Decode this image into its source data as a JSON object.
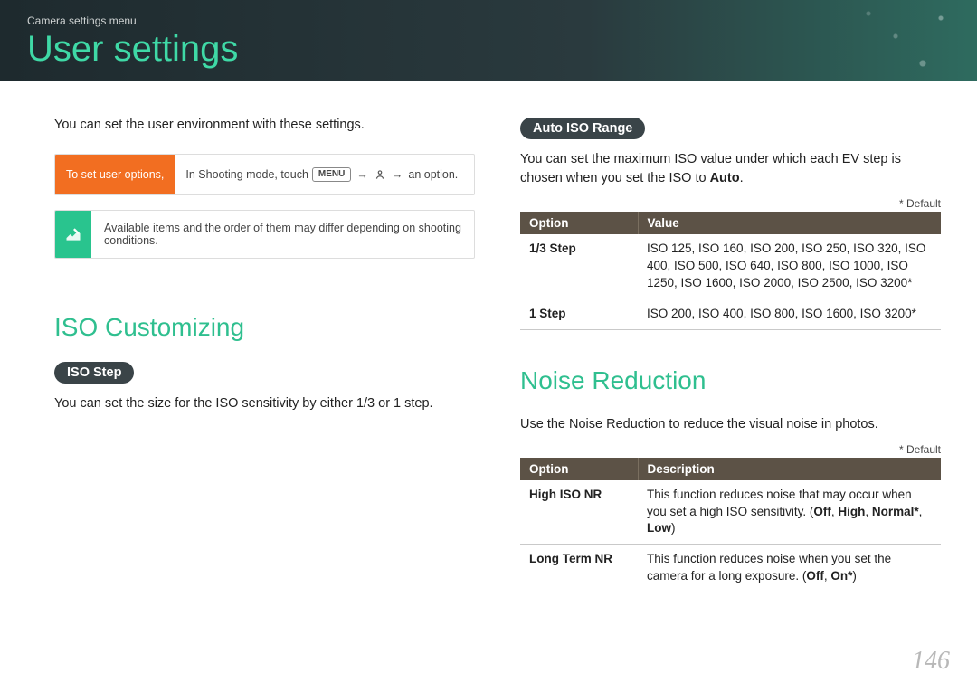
{
  "header": {
    "breadcrumb": "Camera settings menu",
    "title": "User settings"
  },
  "left": {
    "intro": "You can set the user environment with these settings.",
    "callout": {
      "label": "To set user options,",
      "prefix": "In Shooting mode, touch",
      "menu": "MENU",
      "suffix": "an option."
    },
    "note": "Available items and the order of them may differ depending on shooting conditions.",
    "section": "ISO Customizing",
    "pill": "ISO Step",
    "body": "You can set the size for the ISO sensitivity by either 1/3 or 1 step."
  },
  "right": {
    "pill1": "Auto ISO Range",
    "body1a": "You can set the maximum ISO value under which each EV step is chosen when you set the ISO to ",
    "body1b": "Auto",
    "body1c": ".",
    "default": "* Default",
    "table1": {
      "headers": [
        "Option",
        "Value"
      ],
      "rows": [
        {
          "option": "1/3 Step",
          "value": "ISO 125, ISO 160, ISO 200, ISO 250, ISO 320, ISO 400, ISO 500, ISO 640, ISO 800, ISO 1000, ISO 1250, ISO 1600, ISO 2000, ISO 2500, ISO 3200*"
        },
        {
          "option": "1 Step",
          "value": "ISO 200, ISO 400, ISO 800, ISO 1600, ISO 3200*"
        }
      ]
    },
    "section2": "Noise Reduction",
    "body2": "Use the Noise Reduction to reduce the visual noise in photos.",
    "table2": {
      "headers": [
        "Option",
        "Description"
      ],
      "rows": [
        {
          "option": "High ISO NR",
          "desc_pre": "This function reduces noise that may occur when you set a high ISO sensitivity. (",
          "opts": [
            "Off",
            "High",
            "Normal*",
            "Low"
          ],
          "desc_post": ")"
        },
        {
          "option": "Long Term NR",
          "desc_pre": "This function reduces noise when you set the camera for a long exposure. (",
          "opts": [
            "Off",
            "On*"
          ],
          "desc_post": ")"
        }
      ]
    }
  },
  "page_number": "146"
}
